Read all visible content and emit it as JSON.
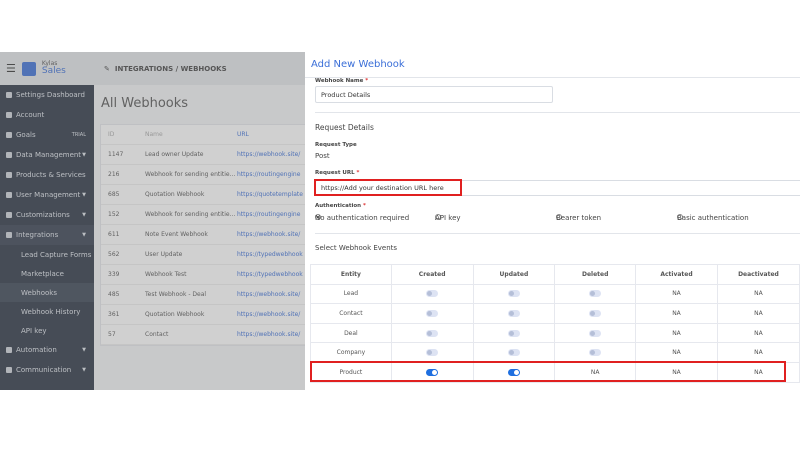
{
  "app": {
    "brand_small": "Kylas",
    "brand": "Sales"
  },
  "sidebar": {
    "items": [
      {
        "label": "Settings Dashboard"
      },
      {
        "label": "Account"
      },
      {
        "label": "Goals",
        "badge": "TRIAL"
      },
      {
        "label": "Data Management"
      },
      {
        "label": "Products & Services"
      },
      {
        "label": "User Management"
      },
      {
        "label": "Customizations"
      },
      {
        "label": "Integrations"
      }
    ],
    "sub_items": [
      {
        "label": "Lead Capture Forms"
      },
      {
        "label": "Marketplace"
      },
      {
        "label": "Webhooks"
      },
      {
        "label": "Webhook History"
      },
      {
        "label": "API key"
      }
    ],
    "bottom_items": [
      {
        "label": "Automation"
      },
      {
        "label": "Communication"
      }
    ]
  },
  "header": {
    "breadcrumb": "INTEGRATIONS / WEBHOOKS"
  },
  "list": {
    "title": "All Webhooks",
    "columns": [
      "ID",
      "Name",
      "URL"
    ],
    "rows": [
      [
        "1147",
        "Lead owner Update",
        "https://webhook.site/"
      ],
      [
        "216",
        "Webhook for sending entitie...",
        "https://routingengine"
      ],
      [
        "685",
        "Quotation Webhook",
        "https://quotetemplate"
      ],
      [
        "152",
        "Webhook for sending entitie...",
        "https://routingengine"
      ],
      [
        "611",
        "Note Event Webhook",
        "https://webhook.site/"
      ],
      [
        "562",
        "User Update",
        "https://typedwebhook"
      ],
      [
        "339",
        "Webhook Test",
        "https://typedwebhook"
      ],
      [
        "485",
        "Test Webhook - Deal",
        "https://webhook.site/"
      ],
      [
        "361",
        "Quotation Webhook",
        "https://webhook.site/"
      ],
      [
        "57",
        "Contact",
        "https://webhook.site/"
      ]
    ]
  },
  "modal": {
    "title": "Add New Webhook",
    "name_label": "Webhook Name",
    "name_value": "Product Details",
    "section": "Request Details",
    "type_label": "Request Type",
    "type_value": "Post",
    "url_label": "Request URL",
    "url_value": "https://Add your destination URL here",
    "auth_label": "Authentication",
    "required_mark": "*",
    "auth_options": [
      {
        "label": "No authentication required",
        "selected": true
      },
      {
        "label": "API key",
        "selected": false
      },
      {
        "label": "Bearer token",
        "selected": false
      },
      {
        "label": "Basic authentication",
        "selected": false
      }
    ],
    "events_title": "Select Webhook Events",
    "events_columns": [
      "Entity",
      "Created",
      "Updated",
      "Deleted",
      "Activated",
      "Deactivated"
    ],
    "events_rows": [
      {
        "entity": "Lead",
        "created": false,
        "updated": false,
        "deleted": false,
        "activated": "NA",
        "deactivated": "NA"
      },
      {
        "entity": "Contact",
        "created": false,
        "updated": false,
        "deleted": false,
        "activated": "NA",
        "deactivated": "NA"
      },
      {
        "entity": "Deal",
        "created": false,
        "updated": false,
        "deleted": false,
        "activated": "NA",
        "deactivated": "NA"
      },
      {
        "entity": "Company",
        "created": false,
        "updated": false,
        "deleted": false,
        "activated": "NA",
        "deactivated": "NA"
      },
      {
        "entity": "Product",
        "created": true,
        "updated": true,
        "deleted": "NA",
        "activated": "NA",
        "deactivated": "NA"
      }
    ]
  },
  "colors": {
    "accent": "#3b6fd8",
    "highlight": "#e02020",
    "toggle_on": "#1e6fe0",
    "sidebar": "#2b3544"
  }
}
